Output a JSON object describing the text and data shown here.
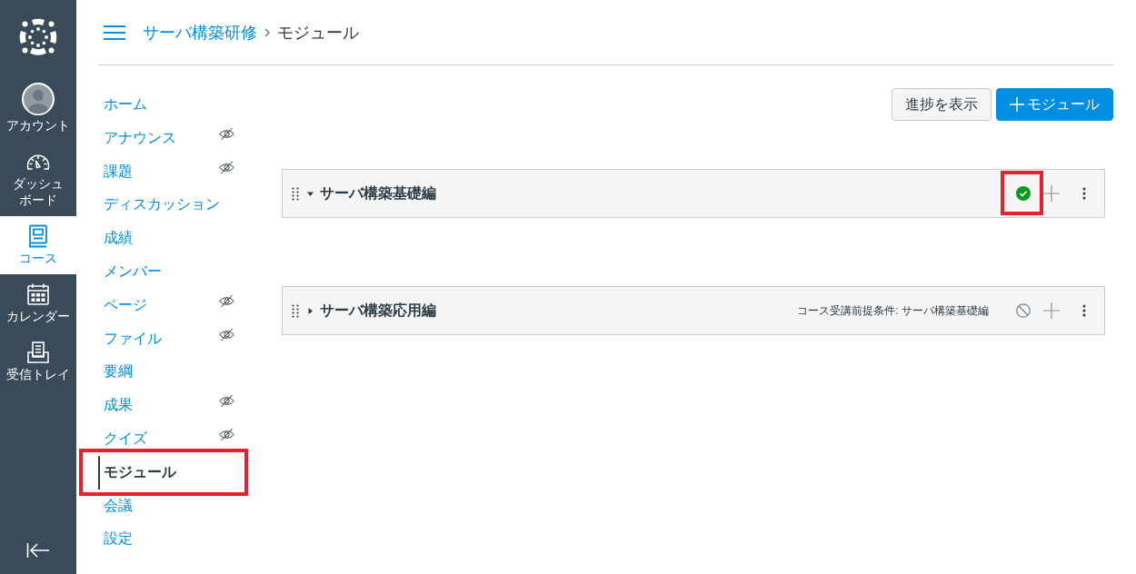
{
  "global_nav": {
    "items": [
      {
        "kind": "account",
        "label": "アカウント",
        "selected": false
      },
      {
        "kind": "dashboard",
        "label": "ダッシュボード",
        "selected": false
      },
      {
        "kind": "courses",
        "label": "コース",
        "selected": true
      },
      {
        "kind": "calendar",
        "label": "カレンダー",
        "selected": false
      },
      {
        "kind": "inbox",
        "label": "受信トレイ",
        "selected": false
      }
    ]
  },
  "header": {
    "breadcrumb": [
      {
        "kind": "link",
        "label": "サーバ構築研修"
      },
      {
        "kind": "current",
        "label": "モジュール"
      }
    ]
  },
  "course_nav": {
    "items": [
      {
        "label": "ホーム",
        "hidden": false,
        "selected": false,
        "highlighted": false
      },
      {
        "label": "アナウンス",
        "hidden": true,
        "selected": false,
        "highlighted": false
      },
      {
        "label": "課題",
        "hidden": true,
        "selected": false,
        "highlighted": false
      },
      {
        "label": "ディスカッション",
        "hidden": false,
        "selected": false,
        "highlighted": false
      },
      {
        "label": "成績",
        "hidden": false,
        "selected": false,
        "highlighted": false
      },
      {
        "label": "メンバー",
        "hidden": false,
        "selected": false,
        "highlighted": false
      },
      {
        "label": "ページ",
        "hidden": true,
        "selected": false,
        "highlighted": false
      },
      {
        "label": "ファイル",
        "hidden": true,
        "selected": false,
        "highlighted": false
      },
      {
        "label": "要綱",
        "hidden": false,
        "selected": false,
        "highlighted": false
      },
      {
        "label": "成果",
        "hidden": true,
        "selected": false,
        "highlighted": false
      },
      {
        "label": "クイズ",
        "hidden": true,
        "selected": false,
        "highlighted": false
      },
      {
        "label": "モジュール",
        "hidden": false,
        "selected": true,
        "highlighted": true
      },
      {
        "label": "会議",
        "hidden": false,
        "selected": false,
        "highlighted": false
      },
      {
        "label": "設定",
        "hidden": false,
        "selected": false,
        "highlighted": false
      }
    ]
  },
  "toolbar": {
    "buttons": [
      {
        "kind": "secondary",
        "label": "進捗を表示"
      },
      {
        "kind": "add",
        "label": "モジュール"
      }
    ]
  },
  "modules": [
    {
      "title": "サーバ構築基礎編",
      "expanded": true,
      "published": true,
      "highlighted": true
    },
    {
      "title": "サーバ構築応用編",
      "expanded": false,
      "published": false,
      "highlighted": false,
      "prerequisite": "コース受講前提条件: サーバ構築基礎編"
    }
  ]
}
